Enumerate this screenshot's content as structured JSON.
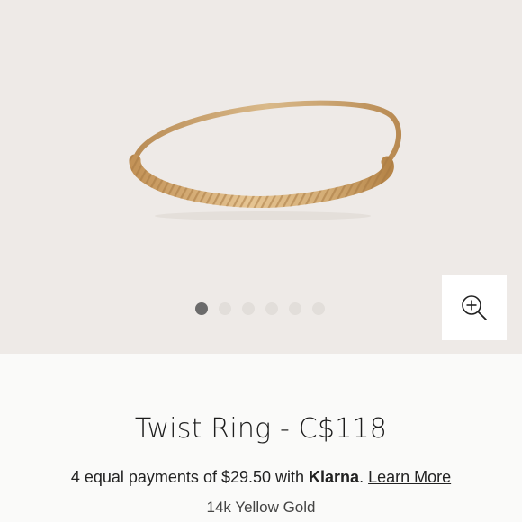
{
  "gallery": {
    "slide_count": 6,
    "active_slide": 1,
    "zoom_icon": "zoom-in-icon"
  },
  "product": {
    "title": "Twist Ring - C$118",
    "variant": "14k Yellow Gold"
  },
  "payment": {
    "prefix": "4 equal payments of $29.50 with ",
    "brand": "Klarna",
    "separator": ". ",
    "learn_more": "Learn More"
  },
  "colors": {
    "gallery_bg": "#eeeae7",
    "gold": "#c9a26a",
    "active_dot": "#6b6b6b",
    "inactive_dot": "#e2deda"
  }
}
